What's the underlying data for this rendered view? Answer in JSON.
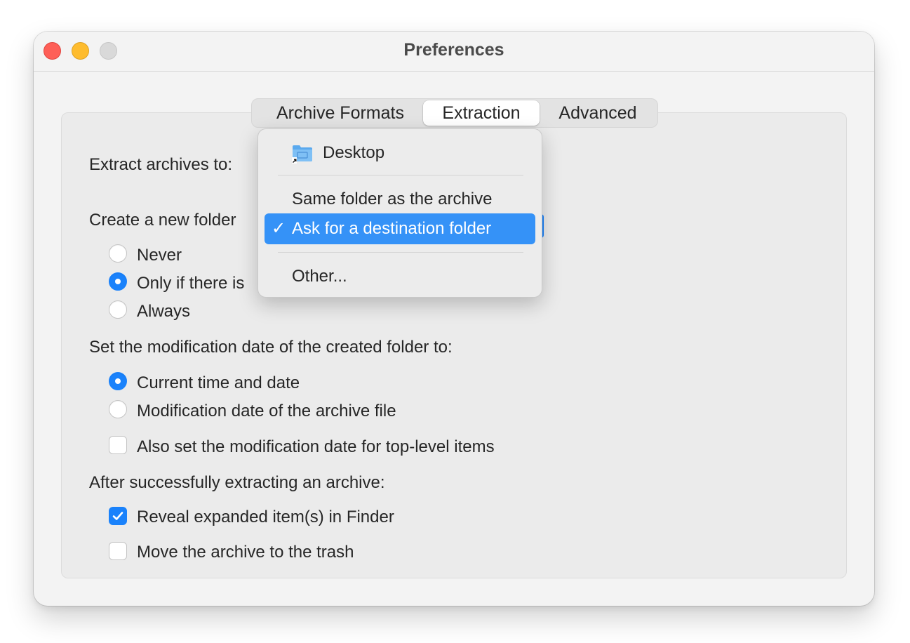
{
  "window": {
    "title": "Preferences",
    "colors": {
      "close": "#fe5f57",
      "minimize": "#febc2e",
      "zoom": "#d9d9d9",
      "accent": "#1a82fb"
    }
  },
  "tabs": [
    {
      "label": "Archive Formats",
      "selected": false
    },
    {
      "label": "Extraction",
      "selected": true
    },
    {
      "label": "Advanced",
      "selected": false
    }
  ],
  "extract_to": {
    "label": "Extract archives to:",
    "menu": {
      "items": [
        {
          "label": "Desktop",
          "icon": "folder-icon"
        },
        {
          "label": "Same folder as the archive"
        },
        {
          "label": "Ask for a destination folder",
          "checked": true,
          "highlighted": true
        },
        {
          "label": "Other..."
        }
      ],
      "check_mark": "✓"
    }
  },
  "new_folder": {
    "label": "Create a new folder",
    "options": [
      {
        "label": "Never",
        "selected": false
      },
      {
        "label": "Only if there is",
        "selected": true
      },
      {
        "label": "Always",
        "selected": false
      }
    ]
  },
  "modification_date": {
    "label": "Set the modification date of the created folder to:",
    "options": [
      {
        "label": "Current time and date",
        "selected": true
      },
      {
        "label": "Modification date of the archive file",
        "selected": false
      }
    ],
    "top_level_checkbox": {
      "label": "Also set the modification date for top-level items",
      "checked": false
    }
  },
  "after_extract": {
    "label": "After successfully extracting an archive:",
    "checkboxes": [
      {
        "label": "Reveal expanded item(s) in Finder",
        "checked": true
      },
      {
        "label": "Move the archive to the trash",
        "checked": false
      }
    ]
  }
}
